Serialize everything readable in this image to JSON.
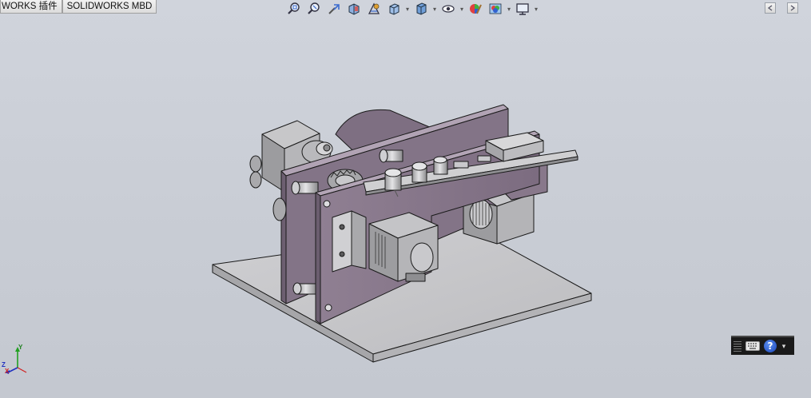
{
  "tabs": [
    {
      "label": "WORKS 插件"
    },
    {
      "label": "SOLIDWORKS MBD"
    }
  ],
  "toolbar": {
    "items": [
      {
        "icon": "zoom-to-fit-icon"
      },
      {
        "icon": "zoom-to-area-icon"
      },
      {
        "icon": "previous-view-icon"
      },
      {
        "icon": "section-view-icon"
      },
      {
        "icon": "dynamic-annotation-icon"
      },
      {
        "icon": "view-orientation-icon",
        "dropdown": true
      },
      {
        "icon": "display-style-icon",
        "dropdown": true
      },
      {
        "icon": "hide-show-items-icon",
        "dropdown": true
      },
      {
        "icon": "edit-appearance-icon"
      },
      {
        "icon": "apply-scene-icon",
        "dropdown": true
      },
      {
        "icon": "view-settings-icon",
        "dropdown": true
      }
    ]
  },
  "window_buttons": [
    {
      "icon": "restore-window-icon"
    },
    {
      "icon": "tile-window-icon"
    }
  ],
  "triad": {
    "x": "X",
    "y": "Y",
    "z": "Z"
  },
  "hud": {
    "help": "?",
    "menu": "▾"
  },
  "colors": {
    "viewport_bg": "#cacdd5",
    "part_purple": "#8a7a8c",
    "part_gray": "#c8c8ca",
    "edge": "#1a1a1a",
    "triad_x": "#d02020",
    "triad_y": "#20a020",
    "triad_z": "#2030c0"
  }
}
